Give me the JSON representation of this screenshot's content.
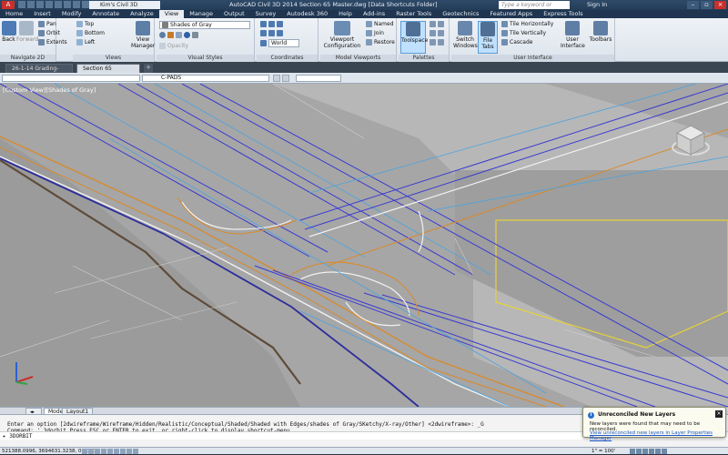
{
  "titlebar": {
    "workspace": "Kim's Civil 3D",
    "title": "AutoCAD Civil 3D 2014    Section 65 Master.dwg [Data Shortcuts Folder]",
    "search_placeholder": "Type a keyword or phrase",
    "signin": "Sign In"
  },
  "menu_tabs": [
    "Home",
    "Insert",
    "Modify",
    "Annotate",
    "Analyze",
    "View",
    "Manage",
    "Output",
    "Survey",
    "Autodesk 360",
    "Help",
    "Add-ins",
    "Raster Tools",
    "Geotechnics",
    "Featured Apps",
    "Express Tools"
  ],
  "active_menu_tab": "View",
  "ribbon": {
    "navigate": {
      "back": "Back",
      "forward": "Forward",
      "pan": "Pan",
      "orbit": "Orbit",
      "extents": "Extents",
      "label": "Navigate 2D"
    },
    "views": {
      "top": "Top",
      "bottom": "Bottom",
      "left": "Left",
      "view_manager": "View Manager",
      "label": "Views"
    },
    "visual_styles": {
      "current": "Shades of Gray",
      "label": "Visual Styles",
      "opacity": "Opacity"
    },
    "coordinates": {
      "world": "World",
      "label": "Coordinates"
    },
    "model_viewports": {
      "viewport_config": "Viewport Configuration",
      "named": "Named",
      "join": "Join",
      "restore": "Restore",
      "label": "Model Viewports"
    },
    "palettes": {
      "toolspace": "Toolspace",
      "label": "Palettes"
    },
    "user_interface": {
      "switch_windows": "Switch Windows",
      "file_tabs": "File Tabs",
      "tile_horizontally": "Tile Horizontally",
      "tile_vertically": "Tile Vertically",
      "cascade": "Cascade",
      "user_interface": "User Interface",
      "toolbars": "Toolbars",
      "label": "User Interface"
    }
  },
  "doc_tabs": [
    "26-1-14 Grading-Sheet*",
    "Section 65 Master*"
  ],
  "active_doc_tab": "Section 65 Master*",
  "layer_current": "C-PADS",
  "viewport_label": "[Custom View][Shades of Gray]",
  "layout_tabs": [
    "Model",
    "Layout1"
  ],
  "command_history": [
    "Enter an option [2dwireframe/Wireframe/Hidden/Realistic/Conceptual/Shaded/Shaded with Edges/shades of Gray/SKetchy/X-ray/Other] <2dwireframe>: _G",
    "Command: '_3dorbit Press ESC or ENTER to exit, or right-click to display shortcut-menu."
  ],
  "command_input": "3DORBIT",
  "status": {
    "coords": "521388.0996, 3694631.3238, 0.0000",
    "scale": "1\" = 100'"
  },
  "notification": {
    "title": "Unreconciled New Layers",
    "message": "New layers were found that may need to be reconciled.",
    "link": "View unreconciled new layers in Layer Properties Manager"
  },
  "colors": {
    "road_orange": "#d98a2a",
    "road_blue": "#3a3ad0",
    "road_cyan": "#4aa3e0",
    "road_white": "#f5f5f5",
    "lot_yellow": "#e6d23a",
    "terrain_gray": "#a9a9a9"
  }
}
